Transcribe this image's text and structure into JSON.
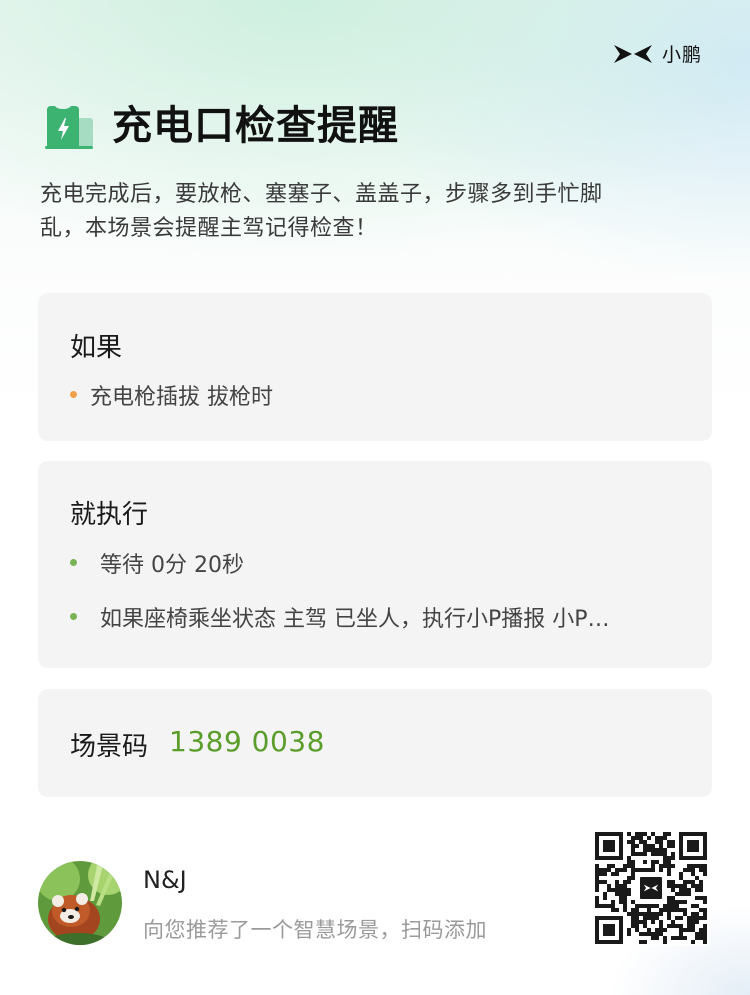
{
  "brand": {
    "name": "小鹏",
    "logo_icon": "xpeng-logo-icon"
  },
  "header": {
    "icon": "charging-battery-icon",
    "title": "充电口检查提醒",
    "description_line1": "充电完成后，要放枪、塞塞子、盖盖子，步骤多到手忙脚",
    "description_line2": "乱，本场景会提醒主驾记得检查！"
  },
  "if_card": {
    "title": "如果",
    "conditions": [
      {
        "text": "充电枪插拔 拔枪时",
        "bullet_color": "#f0a24a"
      }
    ]
  },
  "then_card": {
    "title": "就执行",
    "actions": [
      {
        "text": "等待 0分 20秒",
        "bullet_color": "#7ab356"
      },
      {
        "text": "如果座椅乘坐状态 主驾 已坐人，执行小P播报 小P…",
        "bullet_color": "#7ab356"
      }
    ]
  },
  "scene_code": {
    "label": "场景码",
    "value": "1389 0038",
    "value_color": "#5b9d2a"
  },
  "share": {
    "avatar_icon": "red-panda-avatar",
    "username": "N&J",
    "message": "向您推荐了一个智慧场景，扫码添加",
    "qr_icon": "qr-code-icon"
  },
  "colors": {
    "accent_green": "#5b9d2a",
    "icon_green": "#3cb371",
    "card_bg": "#f4f4f4"
  }
}
